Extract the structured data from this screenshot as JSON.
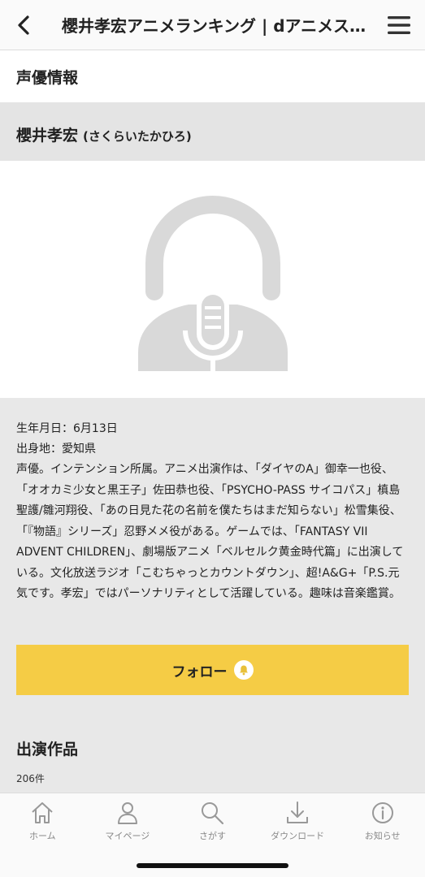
{
  "header": {
    "title": "櫻井孝宏アニメランキング | dアニメストア",
    "back_icon": "chevron-left-icon",
    "menu_icon": "hamburger-menu-icon"
  },
  "section": {
    "title": "声優情報"
  },
  "actor": {
    "name": "櫻井孝宏",
    "kana": "(さくらいたかひろ)",
    "placeholder_icon": "voice-actor-placeholder-icon",
    "birthday": "生年月日：6月13日",
    "birthplace": "出身地：愛知県",
    "bio": "声優。インテンション所属。アニメ出演作は、「ダイヤのA」御幸一也役、「オオカミ少女と黒王子」佐田恭也役、「PSYCHO-PASS サイコパス」槙島聖護/雛河翔役、「あの日見た花の名前を僕たちはまだ知らない」松雪集役、「『物語』シリーズ」忍野メメ役がある。ゲームでは、「FANTASY VII ADVENT CHILDREN」、劇場版アニメ「ベルセルク黄金時代篇」に出演している。文化放送ラジオ「こむちゃっとカウントダウン」、超!A&G+「P.S.元気です。孝宏」ではパーソナリティとして活躍している。趣味は音楽鑑賞。"
  },
  "follow": {
    "label": "フォロー",
    "icon": "bell-icon",
    "color": "#f5cc45"
  },
  "works": {
    "title": "出演作品",
    "count": "206件"
  },
  "tabbar": {
    "tabs": [
      {
        "label": "ホーム",
        "icon": "home-icon"
      },
      {
        "label": "マイページ",
        "icon": "user-icon"
      },
      {
        "label": "さがす",
        "icon": "search-icon"
      },
      {
        "label": "ダウンロード",
        "icon": "download-icon"
      },
      {
        "label": "お知らせ",
        "icon": "info-icon"
      }
    ]
  }
}
